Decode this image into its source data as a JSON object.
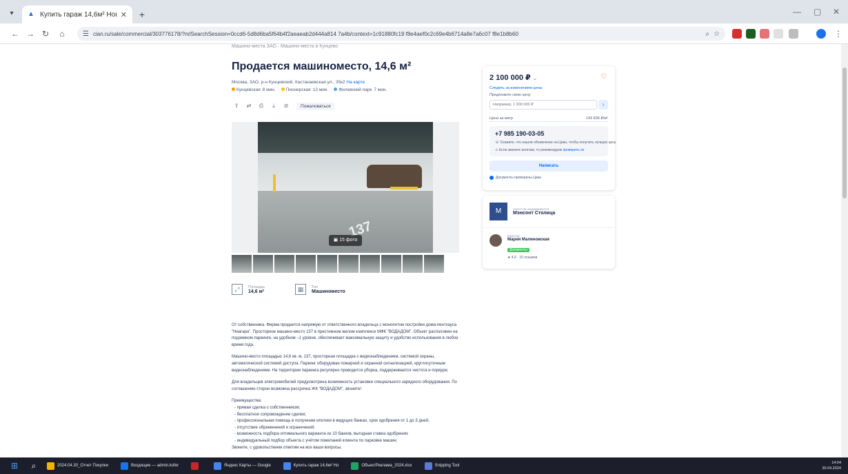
{
  "browser": {
    "tab_title": "Купить гараж 14,6м² Новый...",
    "url": "cian.ru/sale/commercial/303776178/?mlSearchSession=0ccd6-5d8d6ba5f64b4f2aeaeab2d444a814 7a4b/context=1c91880fc19 f8e4aef0c2c69e4b6714a8e7a6c07 f8e1b8b60",
    "zoom_icon": "zoom-icon",
    "star_icon": "star-icon"
  },
  "listing": {
    "breadcrumbs": "Машино-места ЗАО · Машино-места в Кунцево",
    "title": "Продается машиноместо, 14,6 м²",
    "address_prefix": "Москва, ЗАО, р-н Кунцевский, Кастанаевская ул., 35к2",
    "address_link": "На карте",
    "metro": [
      {
        "name": "Кунцевская",
        "time": "8 мин.",
        "color": "#f59b00"
      },
      {
        "name": "Пионерская",
        "time": "13 мин.",
        "color": "#f5c400"
      },
      {
        "name": "Филевский парк",
        "time": "7 мин.",
        "color": "#4aa3df"
      }
    ],
    "complain_label": "Пожаловаться",
    "photo_count": "15 фото",
    "spot_number": "137",
    "specs": [
      {
        "label": "Площадь",
        "value": "14,6 м²"
      },
      {
        "label": "Тип",
        "value": "Машиноместо"
      }
    ],
    "description_paragraphs": [
      "От собственника. Фирма продается напрямую от ответственного владельца с монолитом постройки дома-пентхауса \"Ниагара\". Просторное машино-место 137 в престижном жилом комплексе МФК \"ВОДАДОМ\". Объект расположен на подземном паркинге, на удобном –1 уровне, обеспечивает максимальную защиту и удобство использования в любое время года.",
      "Машино-место площадью 14,6 кв. м, 137, просторная площадка с видеонаблюдением, системой охраны, автоматической системой доступа. Паркинг оборудован пожарной и охранной сигнализацией, круглосуточным видеонаблюдением. На территории паркинга регулярно проводится уборка, поддерживается чистота и порядок.",
      "Для владельцев электромобилей предусмотрена возможность установки специального зарядного оборудования. По соглашению сторон возможна рассрочка ЖК \"ВОДАДОМ\", звоните!"
    ],
    "advantages_title": "Преимущества:",
    "advantages": [
      "- прямая сделка с собственником;",
      "- бесплатное сопровождение сделки;",
      "- профессиональная помощь в получении ипотеки в ведущих банках, срок одобрения от 1 до 3 дней;",
      "- отсутствие обременений и ограничений;",
      "- возможность подбора оптимального варианта из 10 банков, выгодная ставка одобрения;",
      "- индивидуальный подбор объекта с учётом пожеланий клиента по парковке машин;",
      "Звоните, с удовольствием ответим на все ваши вопросы."
    ]
  },
  "sidebar": {
    "price": "2 100 000 ₽",
    "price_history_link": "Следить за изменением цены",
    "offer_label": "Предложите свою цену",
    "offer_placeholder": "Например, 1 900 000 ₽",
    "price_per_sqm_label": "Цена за метр",
    "price_per_sqm_value": "143 836 ₽/м²",
    "phone": "+7 985 190-03-05",
    "phone_note_1": "Скажите, что нашли объявление на Циан, чтобы получить лучшую цену",
    "phone_note_2_text": "Если звоните агентам, то рекомендуем",
    "phone_note_2_link": "проверить их",
    "write_label": "Написать",
    "verified_text": "Документы проверены Циан",
    "agency_kicker": "Агентство недвижимости",
    "agency_name": "Мэнсонт Столица",
    "agency_logo": "М",
    "agent_kicker": "Риелтор",
    "agent_name": "Мария Малиновская",
    "agent_badge": "Документы",
    "agent_rating": "4,9 · 15 отзывов"
  },
  "taskbar": {
    "apps": [
      {
        "label": "2024.04.30_Отчет Покупки",
        "color": "#f4b400"
      },
      {
        "label": "Входящие — admin.kofer",
        "color": "#1a73e8"
      },
      {
        "label": "",
        "color": "#c62828"
      },
      {
        "label": "Яндекс Карты — Google",
        "color": "#4285f4"
      },
      {
        "label": "Купить гараж 14,6м² Но",
        "color": "#4285f4"
      },
      {
        "label": "ОбъектРеклама_2024.xlsx",
        "color": "#21a366"
      },
      {
        "label": "Snipping Tool",
        "color": "#5b7bd5"
      }
    ],
    "time": "14:04",
    "date": "30.04.2024"
  }
}
